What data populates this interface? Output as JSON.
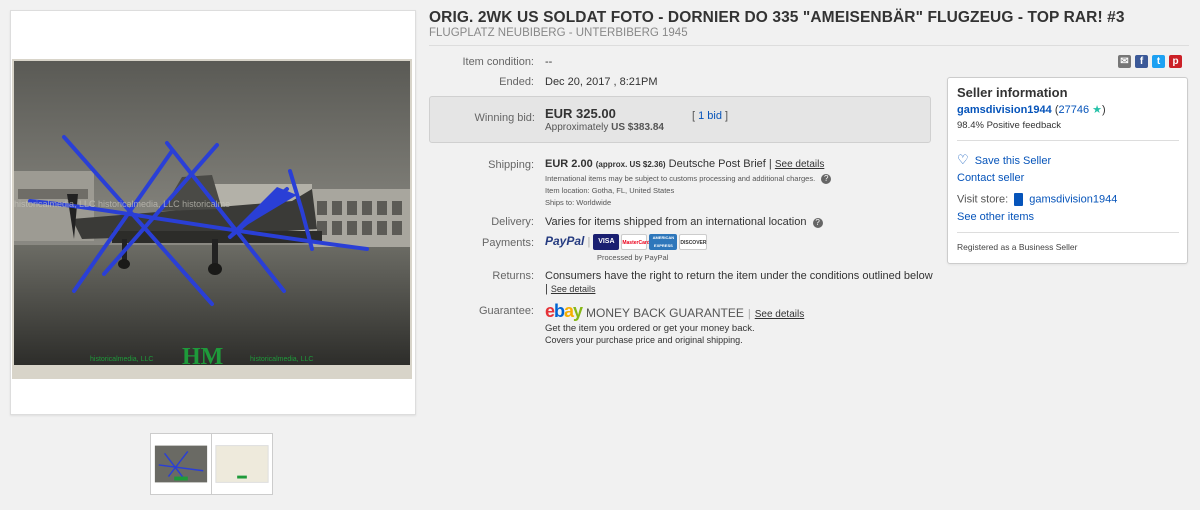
{
  "title": "ORIG. 2WK US SOLDAT FOTO - DORNIER DO 335 \"AMEISENBÄR\" FLUGZEUG - TOP RAR! #3",
  "subtitle": "FLUGPLATZ NEUBIBERG - UNTERBIBERG 1945",
  "photo": {
    "watermark_main": "HM",
    "watermark_left": "historicalmedia, LLC",
    "watermark_right": "historicalmedia, LLC",
    "watermark_top": "historicalmedia, LLC historicalmedia, LLC historicalme"
  },
  "item": {
    "condition_label": "Item condition:",
    "condition_value": "--",
    "ended_label": "Ended:",
    "ended_value": "Dec 20, 2017 , 8:21PM",
    "winning_label": "Winning bid:",
    "winning_price": "EUR 325.00",
    "approx_prefix": "Approximately",
    "approx_value": "US $383.84",
    "bids_link": "1 bid",
    "shipping_label": "Shipping:",
    "shipping_price": "EUR 2.00",
    "shipping_approx": "(approx. US $2.36)",
    "shipping_method": "Deutsche Post Brief",
    "see_details": "See details",
    "intl_note": "International items may be subject to customs processing and additional charges.",
    "item_location": "Item location:  Gotha, FL, United States",
    "ships_to": "Ships to:  Worldwide",
    "delivery_label": "Delivery:",
    "delivery_value": "Varies for items shipped from an international location",
    "payments_label": "Payments:",
    "paypal": "PayPal",
    "processed_by": "Processed by PayPal",
    "cards": [
      "VISA",
      "MasterCard",
      "AMERICAN EXPRESS",
      "DISCOVER"
    ],
    "returns_label": "Returns:",
    "returns_value": "Consumers have the right to return the item under the conditions outlined below",
    "guarantee_label": "Guarantee:",
    "mbg": "MONEY BACK GUARANTEE",
    "mbg_line1": "Get the item you ordered or get your money back.",
    "mbg_line2": "Covers your purchase price and original shipping."
  },
  "seller": {
    "title": "Seller information",
    "name": "gamsdivision1944",
    "score": "27746",
    "feedback": "98.4% Positive feedback",
    "save": "Save this Seller",
    "contact": "Contact seller",
    "visit_label": "Visit store:",
    "store_name": "gamsdivision1944",
    "other_items": "See other items",
    "business": "Registered as a Business Seller"
  },
  "colors": {
    "link": "#0654ba",
    "bid_box": "#e5e5e5",
    "pen_marks": "#2a3fd6",
    "watermark_green": "#1e9a3a"
  }
}
